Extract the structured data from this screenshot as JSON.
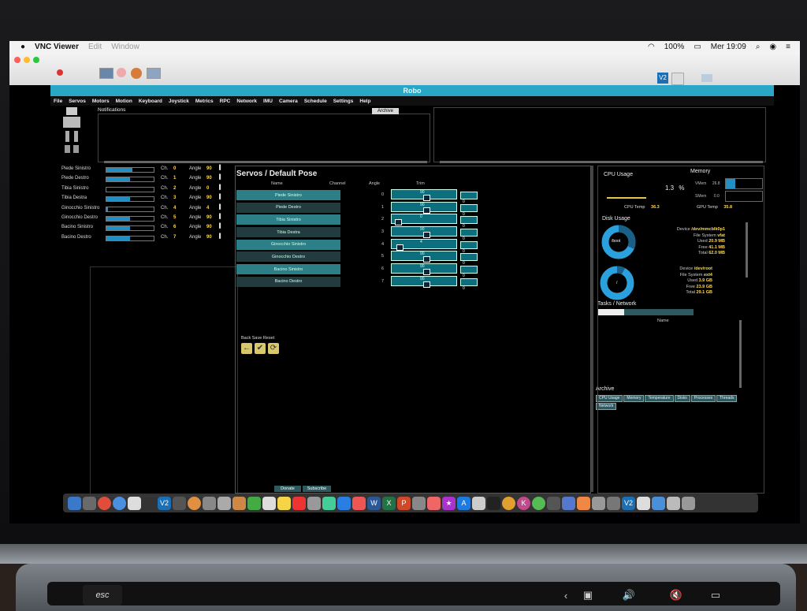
{
  "mac_menubar": {
    "app_name": "VNC Viewer",
    "menus": [
      "Edit",
      "Window"
    ],
    "battery": "100%",
    "clock": "Mer 19:09"
  },
  "app": {
    "title": "Robo",
    "menus": [
      "File",
      "Servos",
      "Motors",
      "Motion",
      "Keyboard",
      "Joystick",
      "Metrics",
      "RPC",
      "Network",
      "IMU",
      "Camera",
      "Schedule",
      "Settings",
      "Help"
    ],
    "notifications_label": "Notifications",
    "archive_button": "Archive"
  },
  "servo_status": {
    "ch_label": "Ch.",
    "angle_label": "Angle",
    "rows": [
      {
        "name": "Piede Sinistro",
        "ch": "0",
        "angle": "90",
        "fill": 0.55
      },
      {
        "name": "Piede Destro",
        "ch": "1",
        "angle": "90",
        "fill": 0.5
      },
      {
        "name": "Tibia Sinistro",
        "ch": "2",
        "angle": "0",
        "fill": 0.0
      },
      {
        "name": "Tibia Destra",
        "ch": "3",
        "angle": "90",
        "fill": 0.5
      },
      {
        "name": "Ginocchio Sinistro",
        "ch": "4",
        "angle": "4",
        "fill": 0.03
      },
      {
        "name": "Ginocchio Destro",
        "ch": "5",
        "angle": "90",
        "fill": 0.5
      },
      {
        "name": "Bacino Sinistro",
        "ch": "6",
        "angle": "90",
        "fill": 0.5
      },
      {
        "name": "Bacino Destro",
        "ch": "7",
        "angle": "90",
        "fill": 0.5
      }
    ]
  },
  "pose_panel": {
    "title": "Servos / Default Pose",
    "headers": {
      "name": "Name",
      "channel": "Channel",
      "angle": "Angle",
      "trim": "Trim"
    },
    "rows": [
      {
        "name": "Piede Sinistro",
        "channel": "0",
        "angle": "90",
        "trim": "0"
      },
      {
        "name": "Piede Destro",
        "channel": "1",
        "angle": "90",
        "trim": "0"
      },
      {
        "name": "Tibia Sinistro",
        "channel": "2",
        "angle": "0",
        "trim": "0"
      },
      {
        "name": "Tibia Destra",
        "channel": "3",
        "angle": "90",
        "trim": "0"
      },
      {
        "name": "Ginocchio Sinistro",
        "channel": "4",
        "angle": "4",
        "trim": "0"
      },
      {
        "name": "Ginocchio Destro",
        "channel": "5",
        "angle": "90",
        "trim": "0"
      },
      {
        "name": "Bacino Sinistro",
        "channel": "6",
        "angle": "90",
        "trim": "0"
      },
      {
        "name": "Bacino Destro",
        "channel": "7",
        "angle": "90",
        "trim": "0"
      }
    ],
    "actions_label": "Back  Save  Reset"
  },
  "metrics": {
    "cpu_usage_title": "CPU Usage",
    "cpu_value": "1.3",
    "cpu_unit": "%",
    "cpu_temp_label": "CPU Temp",
    "cpu_temp": "36.3",
    "memory_title": "Memory",
    "vmem_label": "VMem",
    "vmem_value": "26.8",
    "vmem_fill": 0.27,
    "swap_label": "SMem",
    "swap_value": "0.0",
    "gpu_temp_label": "GPU Temp",
    "gpu_temp": "35.8",
    "disk_title": "Disk Usage",
    "disks": [
      {
        "mount": "/boot",
        "device_label": "Device",
        "device": "/dev/mmcblk0p1",
        "fs_label": "File System",
        "fs": "vfat",
        "used_label": "Used",
        "used": "20.9 MB",
        "free_label": "Free",
        "free": "41.1 MB",
        "total_label": "Total",
        "total": "62.0 MB"
      },
      {
        "mount": "/",
        "device_label": "Device",
        "device": "/dev/root",
        "fs_label": "File System",
        "fs": "ext4",
        "used_label": "Used",
        "used": "3.9 GB",
        "free_label": "Free",
        "free": "23.9 GB",
        "total_label": "Total",
        "total": "29.1 GB"
      }
    ],
    "tasks_title": "Tasks / Network",
    "tasks_name_header": "Name",
    "archive_title": "Archive",
    "archive_items": [
      "CPU Usage",
      "Memory",
      "Temperature",
      "Disks",
      "Processes",
      "Threads",
      "Network"
    ]
  },
  "footer": {
    "donate": "Donate",
    "subscribe": "Subscribe"
  },
  "touchbar": {
    "esc": "esc"
  },
  "colors": {
    "accent": "#1f8fc6",
    "teal": "#2d7f87",
    "value_yellow": "#ffd84a",
    "titlebar": "#2aa6c7"
  }
}
